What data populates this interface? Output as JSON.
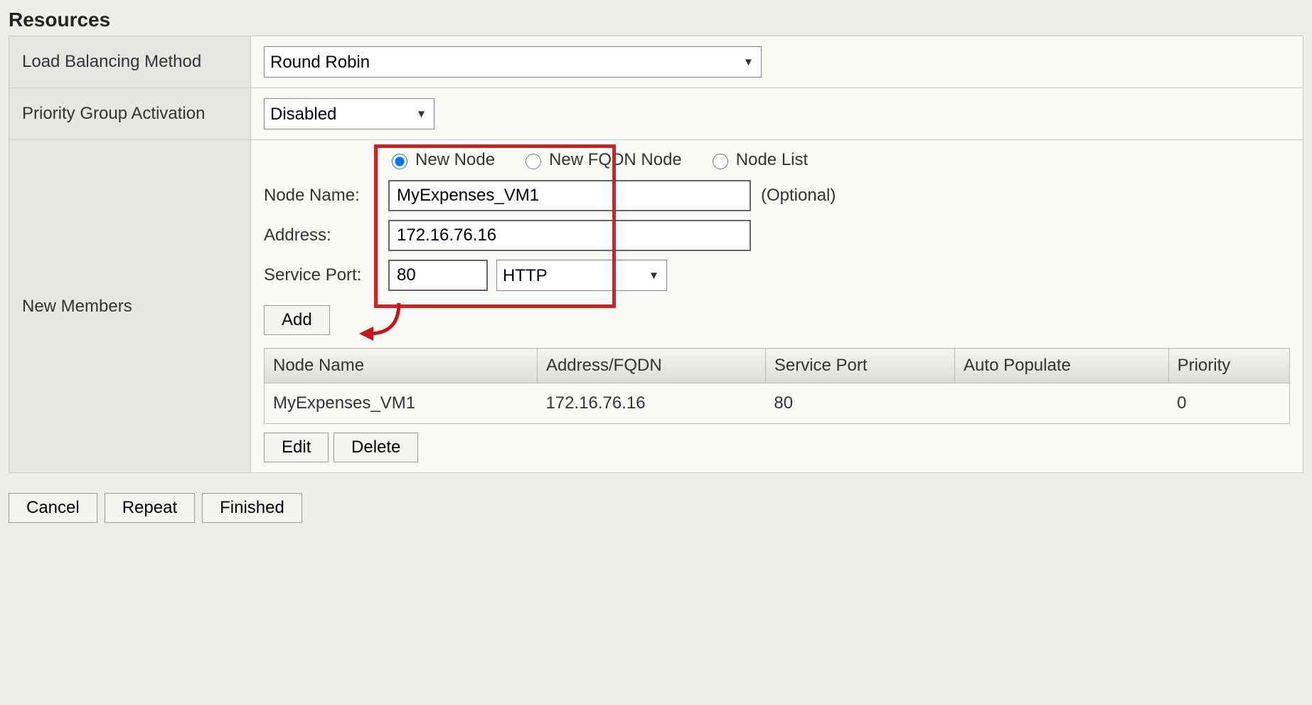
{
  "section_title": "Resources",
  "rows": {
    "lb_method": {
      "label": "Load Balancing Method",
      "value": "Round Robin"
    },
    "priority_group": {
      "label": "Priority Group Activation",
      "value": "Disabled"
    },
    "new_members": {
      "label": "New Members"
    }
  },
  "node_type": {
    "new_node": "New Node",
    "new_fqdn": "New FQDN Node",
    "node_list": "Node List",
    "selected": "new_node"
  },
  "fields": {
    "node_name": {
      "label": "Node Name:",
      "value": "MyExpenses_VM1",
      "optional": "(Optional)"
    },
    "address": {
      "label": "Address:",
      "value": "172.16.76.16"
    },
    "service_port": {
      "label": "Service Port:",
      "value": "80",
      "proto": "HTTP"
    }
  },
  "buttons": {
    "add": "Add",
    "edit": "Edit",
    "delete": "Delete",
    "cancel": "Cancel",
    "repeat": "Repeat",
    "finished": "Finished"
  },
  "members_table": {
    "headers": {
      "node_name": "Node Name",
      "address": "Address/FQDN",
      "service_port": "Service Port",
      "auto_populate": "Auto Populate",
      "priority": "Priority"
    },
    "rows": [
      {
        "node_name": "MyExpenses_VM1",
        "address": "172.16.76.16",
        "service_port": "80",
        "auto_populate": "",
        "priority": "0"
      }
    ]
  }
}
